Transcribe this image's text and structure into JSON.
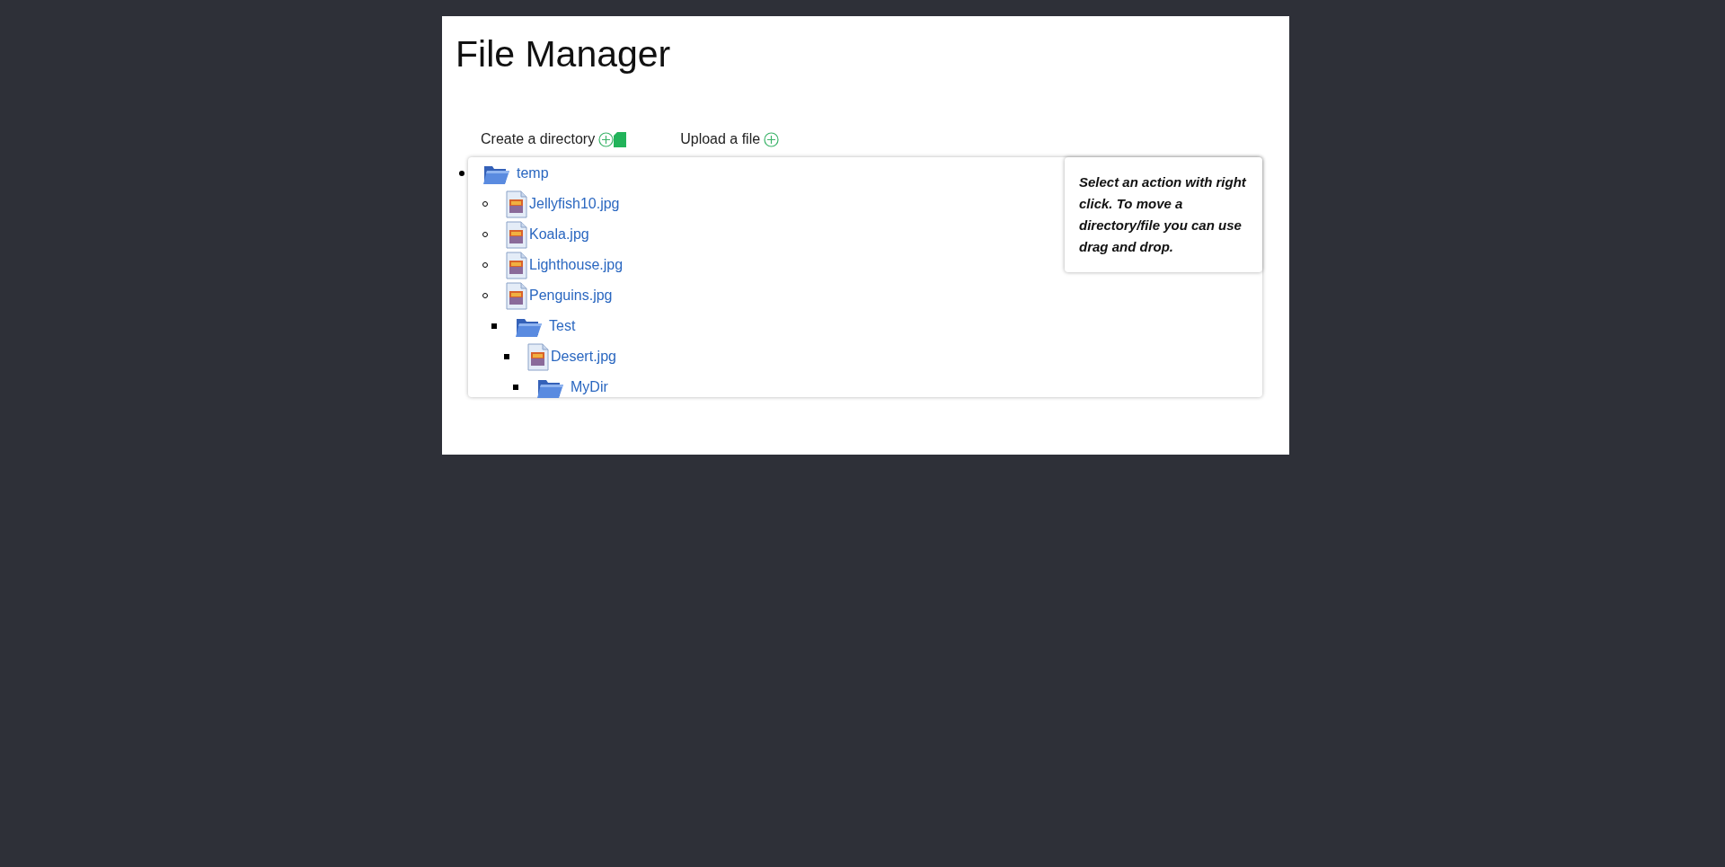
{
  "title": "File Manager",
  "actions": [
    {
      "label": "Create a directory",
      "kind": "directory"
    },
    {
      "label": "Upload a file",
      "kind": "upload"
    }
  ],
  "tree": [
    {
      "name": "temp",
      "kind": "folder",
      "children": [
        {
          "name": "Jellyfish10.jpg",
          "kind": "file"
        },
        {
          "name": "Koala.jpg",
          "kind": "file"
        },
        {
          "name": "Lighthouse.jpg",
          "kind": "file"
        },
        {
          "name": "Penguins.jpg",
          "kind": "file"
        },
        {
          "name": "Test",
          "kind": "folder",
          "children": [
            {
              "name": "Desert.jpg",
              "kind": "file"
            },
            {
              "name": "MyDir",
              "kind": "folder"
            }
          ]
        }
      ]
    }
  ],
  "hint": "Select an action with right click. To move a directory/file you can use drag and drop."
}
